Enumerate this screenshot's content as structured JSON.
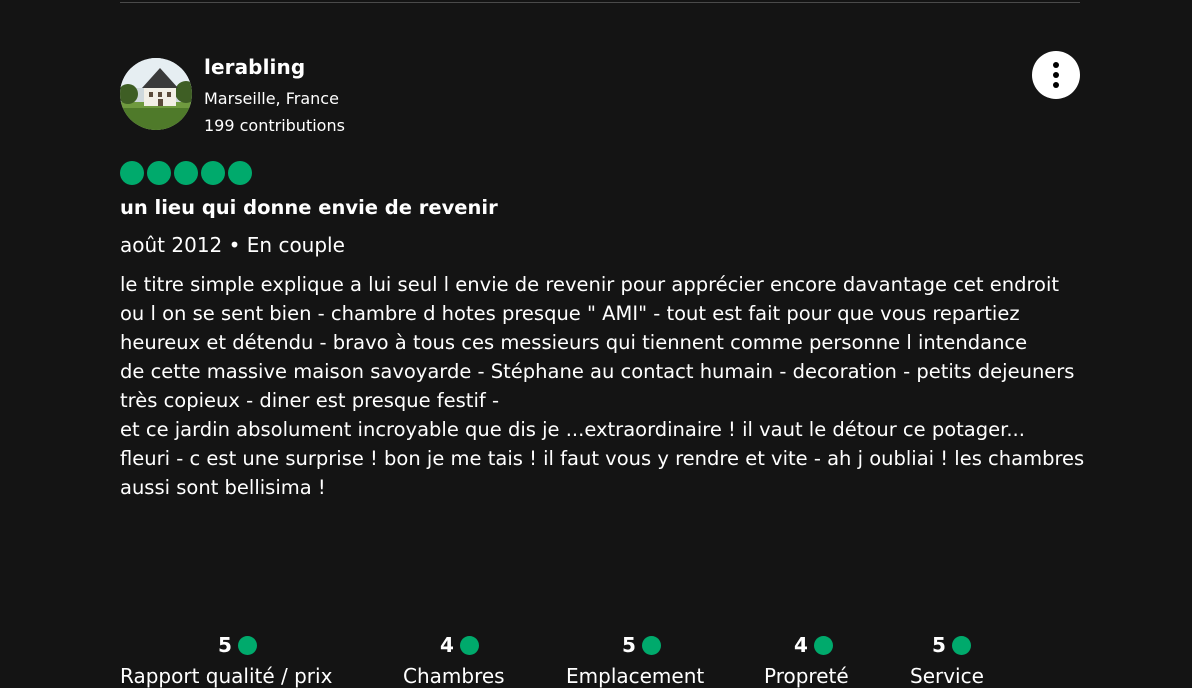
{
  "reviewer": {
    "name": "lerabling",
    "location": "Marseille, France",
    "contributions": "199 contributions"
  },
  "review": {
    "rating": 5,
    "title": "un lieu qui donne envie de revenir",
    "meta": "août 2012 • En couple",
    "body_lines": [
      "le titre simple explique a lui seul l envie de revenir pour apprécier encore davantage cet endroit ou l on se sent bien - chambre d hotes presque \" AMI\" - tout est fait pour que vous repartiez",
      "heureux et détendu - bravo à tous ces messieurs qui tiennent comme personne l intendance",
      "de cette massive maison savoyarde - Stéphane au contact humain - decoration - petits dejeuners très copieux - diner est presque festif -",
      "et ce jardin absolument incroyable que dis je ...extraordinaire ! il vaut le détour ce potager...",
      "fleuri - c est une surprise ! bon je me tais ! il faut vous y rendre et vite - ah j oubliai ! les chambres",
      "aussi sont bellisima !"
    ]
  },
  "subratings": [
    {
      "score": "5",
      "label": "Rapport qualité / prix"
    },
    {
      "score": "4",
      "label": "Chambres"
    },
    {
      "score": "5",
      "label": "Emplacement"
    },
    {
      "score": "4",
      "label": "Propreté"
    },
    {
      "score": "5",
      "label": "Service"
    }
  ],
  "colors": {
    "background": "#141414",
    "accent": "#00aa6c",
    "text": "#ffffff"
  },
  "icons": {
    "more": "more-vertical-icon",
    "rating": "rating-bubble-icon"
  }
}
